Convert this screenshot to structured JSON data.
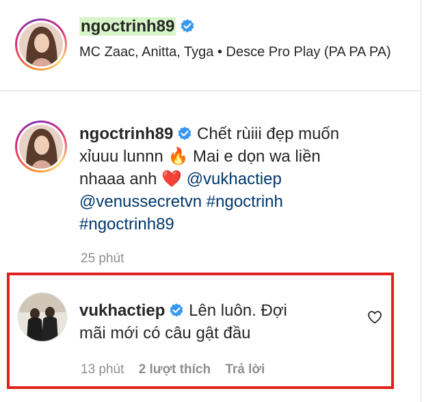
{
  "header": {
    "username": "ngoctrinh89",
    "audio_line": "MC Zaac, Anitta, Tyga • Desce Pro Play (PA PA PA)"
  },
  "caption": {
    "username": "ngoctrinh89",
    "text_line1": "Chết rùiii đẹp muốn",
    "text_line2_a": "xỉuuu lunnn",
    "text_line2_emoji": "🔥",
    "text_line2_b": "Mai e dọn wa liền",
    "text_line3_a": "nhaaa anh",
    "text_line3_emoji": "❤️",
    "mention_1": "@vukhactiep",
    "mention_2": "@venussecretvn",
    "hashtag_1": "#ngoctrinh",
    "hashtag_2": "#ngoctrinh89",
    "time": "25 phút"
  },
  "reply": {
    "username": "vukhactiep",
    "text_line1": "Lên luôn. Đợi",
    "text_line2": "mãi mới có câu gật đầu",
    "time": "13 phút",
    "likes": "2 lượt thích",
    "reply_label": "Trả lời"
  },
  "colors": {
    "highlight_border": "#e0201b",
    "link": "#00376b",
    "meta_gray": "#8e8e8e",
    "verified_blue": "#3897f0",
    "username_highlight": "#d6f5c8"
  },
  "icons": [
    "verified-badge-icon",
    "heart-icon"
  ]
}
